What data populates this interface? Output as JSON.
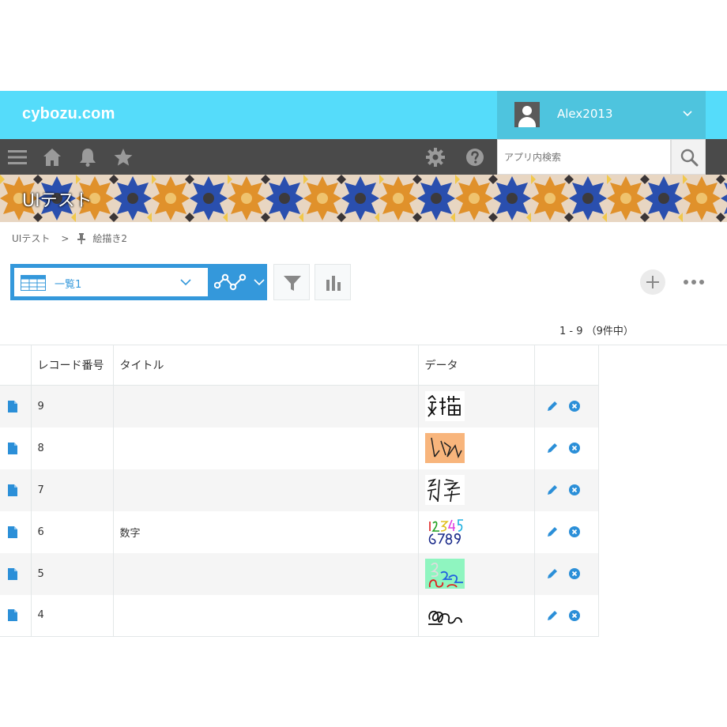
{
  "header": {
    "logo": "cybozu.com",
    "user_name": "Alex2013"
  },
  "nav": {
    "search_placeholder": "アプリ内検索"
  },
  "banner": {
    "title": "UIテスト"
  },
  "breadcrumb": {
    "app": "UIテスト",
    "separator": ">",
    "current": "絵描き2"
  },
  "toolbar": {
    "view_label": "一覧1"
  },
  "pagination": {
    "count_text": "1 - 9 （9件中）"
  },
  "table": {
    "columns": [
      "",
      "レコード番号",
      "タイトル",
      "データ",
      ""
    ],
    "rows": [
      {
        "id": "9",
        "title": "",
        "thumb": "kanji"
      },
      {
        "id": "8",
        "title": "",
        "thumb": "orange-scribble"
      },
      {
        "id": "7",
        "title": "",
        "thumb": "scribble-chars"
      },
      {
        "id": "6",
        "title": "数字",
        "thumb": "digits"
      },
      {
        "id": "5",
        "title": "",
        "thumb": "green-scribble"
      },
      {
        "id": "4",
        "title": "",
        "thumb": "loops"
      }
    ]
  },
  "colors": {
    "header_bg": "#55dcfa",
    "user_box_bg": "#4ec4de",
    "navbar_bg": "#4a4a4a",
    "accent": "#3498db"
  }
}
